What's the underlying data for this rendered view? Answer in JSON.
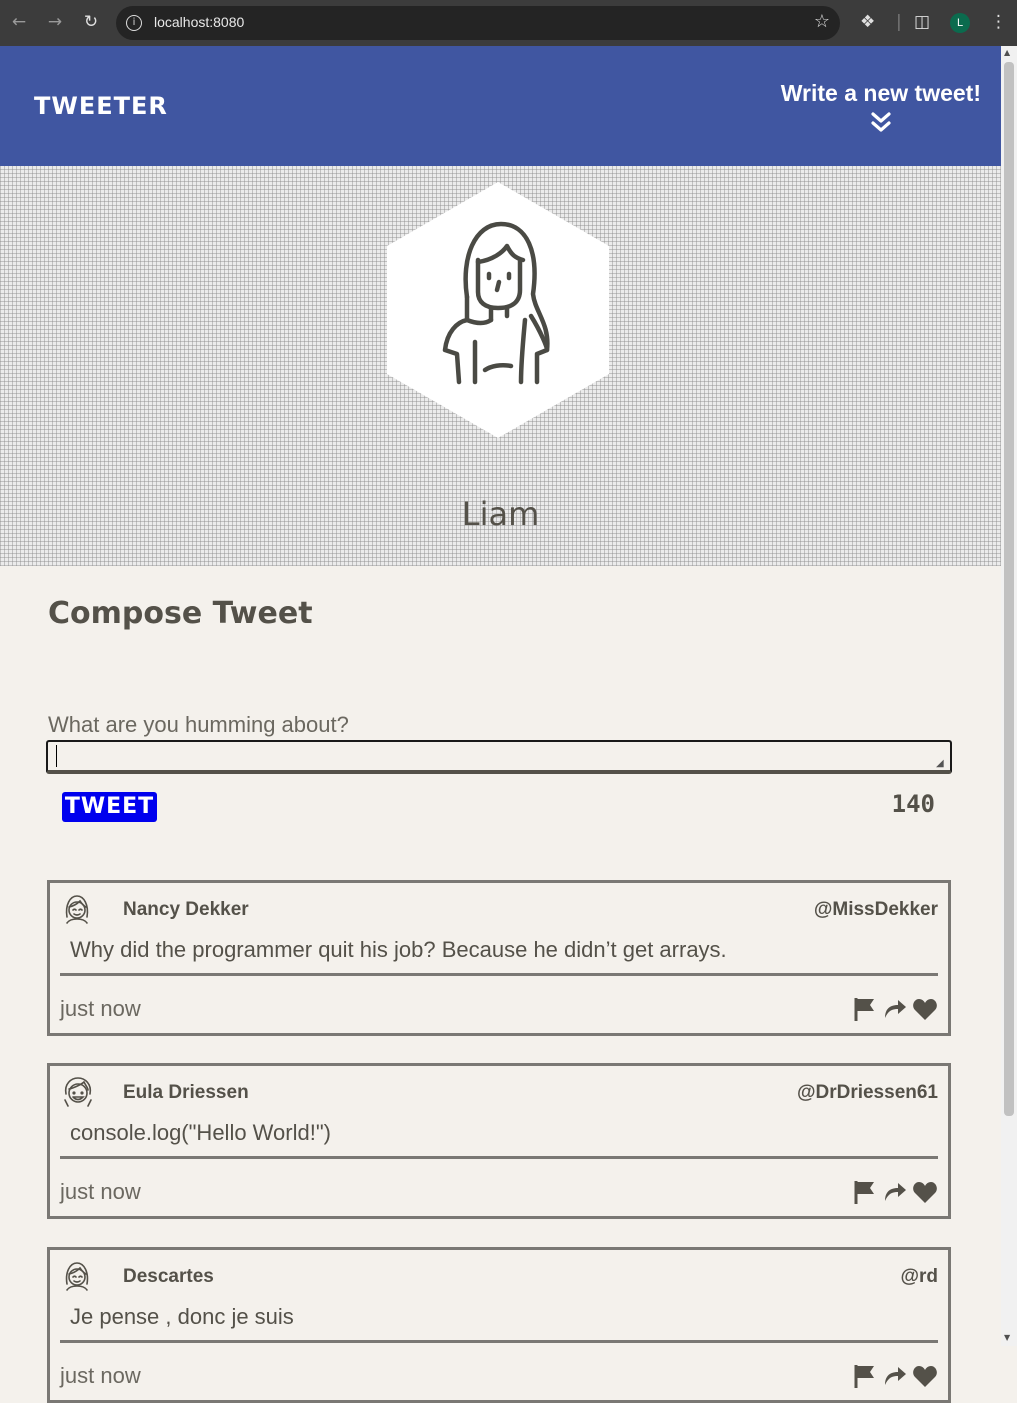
{
  "browser": {
    "url": "localhost:8080",
    "profile_initial": "L"
  },
  "header": {
    "logo": "TWEETER",
    "write_new": "Write a new tweet!",
    "color": "#4056a1"
  },
  "profile": {
    "name": "Liam"
  },
  "compose": {
    "title": "Compose Tweet",
    "label": "What are you humming about?",
    "textarea_value": "",
    "button_label": "TWEET",
    "counter": "140",
    "button_color": "#0000ee"
  },
  "tweets": [
    {
      "name": "Nancy Dekker",
      "handle": "@MissDekker",
      "content": "Why did the programmer quit his job? Because he didn’t get arrays.",
      "time": "just now"
    },
    {
      "name": "Eula Driessen",
      "handle": "@DrDriessen61",
      "content": "console.log(\"Hello World!\")",
      "time": "just now"
    },
    {
      "name": "Descartes",
      "handle": "@rd",
      "content": "Je pense , donc je suis",
      "time": "just now"
    }
  ],
  "icons": {
    "flag": "flag-icon",
    "retweet": "retweet-icon",
    "like": "heart-icon"
  }
}
